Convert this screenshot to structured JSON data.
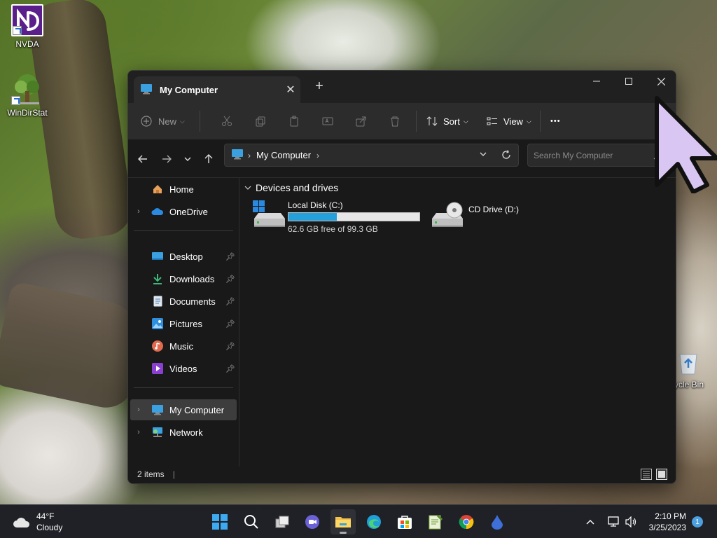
{
  "desktop": {
    "icons": [
      {
        "label": "NVDA"
      },
      {
        "label": "WinDirStat"
      },
      {
        "label": "ycle Bin"
      }
    ]
  },
  "window": {
    "tab_title": "My Computer",
    "tab_close": "✕",
    "new_tab": "+",
    "controls": {
      "minimize": "—",
      "maximize": "☐",
      "close": "✕"
    },
    "toolbar": {
      "new_label": "New",
      "sort_label": "Sort",
      "view_label": "View",
      "more_label": "•••"
    },
    "address": {
      "crumb": "My Computer",
      "separator": "›"
    },
    "search": {
      "placeholder": "Search My Computer"
    },
    "sidebar": {
      "items": [
        {
          "label": "Home"
        },
        {
          "label": "OneDrive"
        },
        {
          "label": "Desktop"
        },
        {
          "label": "Downloads"
        },
        {
          "label": "Documents"
        },
        {
          "label": "Pictures"
        },
        {
          "label": "Music"
        },
        {
          "label": "Videos"
        },
        {
          "label": "My Computer"
        },
        {
          "label": "Network"
        }
      ]
    },
    "content": {
      "section_title": "Devices and drives",
      "drives": [
        {
          "name": "Local Disk (C:)",
          "free_text": "62.6 GB free of 99.3 GB",
          "used_fraction": 0.37
        },
        {
          "name": "CD Drive (D:)"
        }
      ]
    },
    "status": {
      "items_text": "2 items"
    }
  },
  "taskbar": {
    "weather": {
      "temp": "44°F",
      "condition": "Cloudy"
    },
    "clock": {
      "time": "2:10 PM",
      "date": "3/25/2023"
    },
    "notification_count": "1",
    "accent": "#26a0da"
  }
}
